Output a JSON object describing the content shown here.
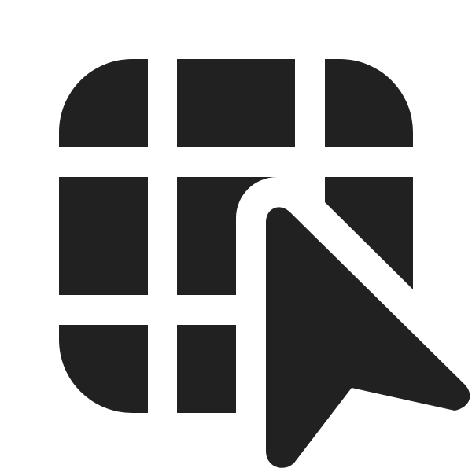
{
  "icon": {
    "name": "table-cursor-icon",
    "color": "#212121",
    "background": "#ffffff"
  }
}
